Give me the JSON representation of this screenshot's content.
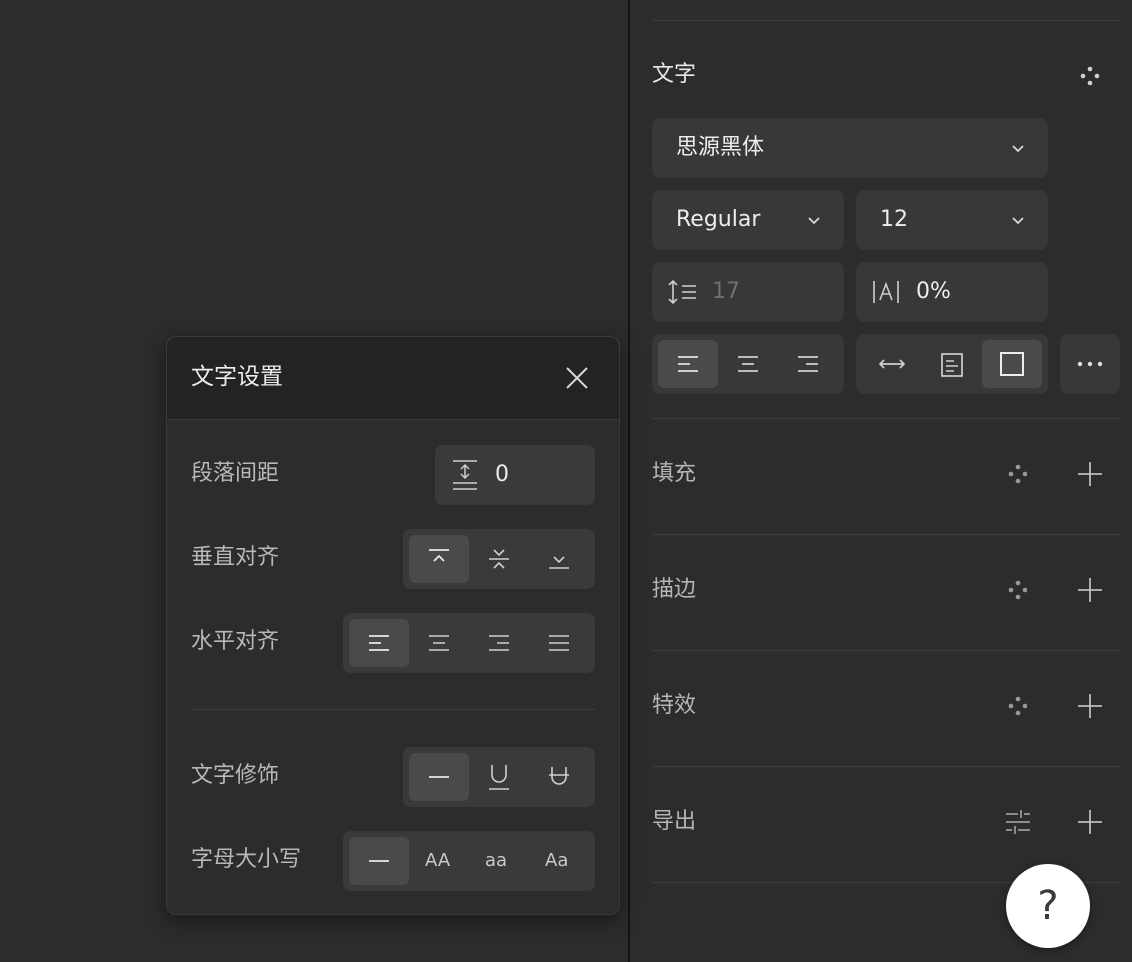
{
  "text_section": {
    "title": "文字",
    "font_family": "思源黑体",
    "font_weight": "Regular",
    "font_size": "12",
    "line_height_placeholder": "17",
    "letter_spacing": "0%",
    "horizontal_align_selected": "left",
    "resize_mode_selected": "fixed"
  },
  "sections": {
    "fill": "填充",
    "stroke": "描边",
    "effects": "特效",
    "export": "导出"
  },
  "help_label": "?",
  "text_settings_popup": {
    "title": "文字设置",
    "paragraph_spacing_label": "段落间距",
    "paragraph_spacing_value": "0",
    "vertical_align_label": "垂直对齐",
    "vertical_align_selected": "top",
    "horizontal_align_label": "水平对齐",
    "horizontal_align_selected": "left",
    "decoration_label": "文字修饰",
    "decoration_selected": "none",
    "case_label": "字母大小写",
    "case_selected": "none",
    "case_options": {
      "upper": "AA",
      "lower": "aa",
      "title": "Aa"
    }
  },
  "colors": {
    "panel_bg": "#2c2c2c",
    "input_bg": "#383838",
    "active_bg": "#4a4a4a",
    "divider": "#141414"
  }
}
